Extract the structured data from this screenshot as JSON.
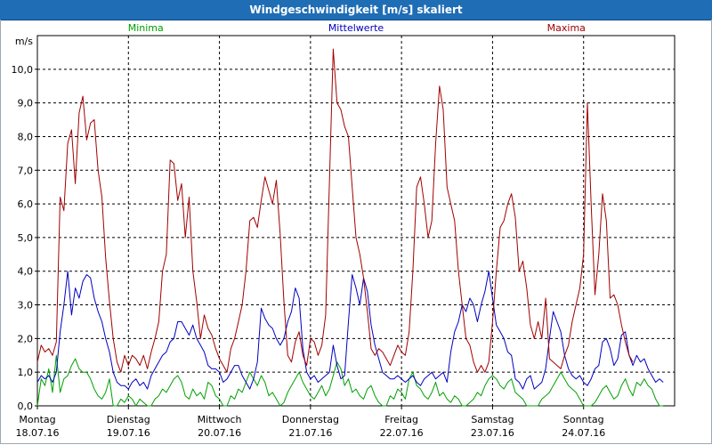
{
  "window": {
    "title": "Windgeschwindigkeit [m/s] skaliert"
  },
  "colors": {
    "title_bar": "#1f6db5",
    "minima": "#00a000",
    "mittelwerte": "#0000c0",
    "maxima": "#a00000"
  },
  "chart_data": {
    "type": "line",
    "title": "Windgeschwindigkeit [m/s] skaliert",
    "ylabel": "m/s",
    "xlabel": "",
    "ylim": [
      0,
      11
    ],
    "yticks": [
      "0,0",
      "1,0",
      "2,0",
      "3,0",
      "4,0",
      "5,0",
      "6,0",
      "7,0",
      "8,0",
      "9,0",
      "10,0"
    ],
    "x_categories": [
      {
        "day": "Montag",
        "date": "18.07.16"
      },
      {
        "day": "Dienstag",
        "date": "19.07.16"
      },
      {
        "day": "Mittwoch",
        "date": "20.07.16"
      },
      {
        "day": "Donnerstag",
        "date": "21.07.16"
      },
      {
        "day": "Freitag",
        "date": "22.07.16"
      },
      {
        "day": "Samstag",
        "date": "23.07.16"
      },
      {
        "day": "Sonntag",
        "date": "24.07.16"
      }
    ],
    "grid": true,
    "legend_placement": "top",
    "samples_per_day": 24,
    "series": [
      {
        "name": "Minima",
        "color": "#00a000",
        "values": [
          0,
          0.8,
          0.6,
          1.1,
          0.4,
          1.5,
          0.4,
          0.8,
          0.9,
          1.2,
          1.4,
          1.1,
          1,
          1,
          0.8,
          0.5,
          0.3,
          0.2,
          0.4,
          0.8,
          0,
          0,
          0.2,
          0.1,
          0.3,
          0.2,
          0,
          0.2,
          0.1,
          0,
          0,
          0.2,
          0.3,
          0.5,
          0.4,
          0.6,
          0.8,
          0.9,
          0.7,
          0.3,
          0.2,
          0.5,
          0.3,
          0.4,
          0.2,
          0.7,
          0.6,
          0.3,
          0.2,
          0,
          0,
          0.3,
          0.2,
          0.5,
          0.4,
          0.7,
          1,
          0.8,
          0.6,
          0.9,
          0.7,
          0.3,
          0.4,
          0.2,
          0,
          0.1,
          0.4,
          0.6,
          0.8,
          1,
          0.7,
          0.5,
          0.3,
          0.2,
          0.4,
          0.6,
          0.3,
          0.5,
          0.9,
          1.3,
          1.1,
          0.6,
          0.8,
          0.4,
          0.5,
          0.3,
          0.2,
          0.5,
          0.6,
          0.3,
          0.1,
          0,
          0,
          0.3,
          0.2,
          0.5,
          0.4,
          0.2,
          0.8,
          1.0,
          0.6,
          0.5,
          0.3,
          0.2,
          0.4,
          0.7,
          0.3,
          0.4,
          0.2,
          0.1,
          0.3,
          0.2,
          0,
          0,
          0.1,
          0.2,
          0.4,
          0.3,
          0.6,
          0.8,
          0.9,
          0.8,
          0.6,
          0.5,
          0.7,
          0.8,
          0.4,
          0.3,
          0.2,
          0,
          0,
          0,
          0,
          0.2,
          0.3,
          0.4,
          0.6,
          0.8,
          1.0,
          0.8,
          0.6,
          0.5,
          0.4,
          0.2,
          0,
          0,
          0,
          0.1,
          0.3,
          0.5,
          0.6,
          0.4,
          0.2,
          0.3,
          0.6,
          0.8,
          0.5,
          0.3,
          0.7,
          0.6,
          0.8,
          0.6,
          0.5,
          0.2,
          0,
          0
        ]
      },
      {
        "name": "Mittelwerte",
        "color": "#0000c0",
        "values": [
          0.7,
          0.9,
          0.8,
          0.9,
          0.7,
          1,
          2.2,
          3,
          4,
          2.7,
          3.5,
          3.2,
          3.7,
          3.9,
          3.8,
          3.2,
          2.8,
          2.5,
          2,
          1.6,
          1,
          0.7,
          0.6,
          0.6,
          0.5,
          0.7,
          0.8,
          0.6,
          0.7,
          0.5,
          0.9,
          1.1,
          1.3,
          1.5,
          1.6,
          1.9,
          2,
          2.5,
          2.5,
          2.3,
          2.1,
          2.4,
          2.0,
          1.8,
          1.6,
          1.2,
          1.1,
          1.1,
          1,
          0.7,
          0.8,
          1,
          1.2,
          1.2,
          0.9,
          0.7,
          0.5,
          0.8,
          1.3,
          2.9,
          2.6,
          2.4,
          2.3,
          2,
          1.8,
          2,
          2.5,
          2.8,
          3.5,
          3.2,
          1.7,
          1,
          0.8,
          0.9,
          0.7,
          0.8,
          0.9,
          1,
          1.8,
          1.2,
          0.8,
          0.9,
          2.5,
          3.9,
          3.5,
          3,
          3.8,
          3.4,
          2.4,
          1.8,
          1.4,
          1.0,
          0.9,
          0.8,
          0.8,
          0.9,
          0.8,
          0.7,
          0.8,
          0.9,
          0.7,
          0.6,
          0.8,
          0.9,
          1,
          0.8,
          0.9,
          1,
          0.7,
          1.6,
          2.2,
          2.5,
          3.0,
          2.8,
          3.2,
          3.0,
          2.5,
          3.0,
          3.4,
          4,
          3.2,
          2.4,
          2.2,
          2,
          1.6,
          1.5,
          0.8,
          0.7,
          0.5,
          0.8,
          0.9,
          0.5,
          0.6,
          0.7,
          1.1,
          2,
          2.8,
          2.5,
          2.2,
          1.5,
          1.1,
          0.9,
          0.8,
          0.9,
          0.7,
          0.6,
          0.8,
          1.1,
          1.2,
          1.9,
          2,
          1.7,
          1.2,
          1.4,
          2.1,
          2.2,
          1.5,
          1.2,
          1.5,
          1.3,
          1.4,
          1.1,
          0.9,
          0.7,
          0.8,
          0.7
        ]
      },
      {
        "name": "Maxima",
        "color": "#a00000",
        "values": [
          1.3,
          1.8,
          1.6,
          1.7,
          1.5,
          1.9,
          6.2,
          5.8,
          7.8,
          8.2,
          6.6,
          8.7,
          9.2,
          7.9,
          8.4,
          8.5,
          7,
          6.2,
          4.4,
          3.1,
          2,
          1.3,
          1,
          1.5,
          1.2,
          1.5,
          1.4,
          1.2,
          1.5,
          1.1,
          1.6,
          2,
          2.5,
          4,
          4.5,
          7.3,
          7.2,
          6.1,
          6.6,
          5,
          6.2,
          4,
          3.1,
          2,
          2.7,
          2.3,
          2.1,
          1.7,
          1.4,
          1.2,
          1.0,
          1.7,
          2,
          2.5,
          3,
          4,
          5.5,
          5.6,
          5.3,
          6.1,
          6.8,
          6.4,
          6.0,
          6.7,
          5.1,
          3.1,
          1.5,
          1.3,
          1.9,
          2.2,
          1.5,
          1.2,
          2.0,
          1.9,
          1.5,
          1.8,
          2.7,
          6.7,
          10.6,
          9.0,
          8.8,
          8.3,
          8.0,
          6.5,
          5.0,
          4.5,
          3.8,
          2.8,
          1.7,
          1.5,
          1.7,
          1.6,
          1.4,
          1.2,
          1.5,
          1.8,
          1.6,
          1.5,
          2.2,
          4.0,
          6.5,
          6.8,
          6.0,
          5.0,
          5.5,
          7.8,
          9.5,
          8.8,
          6.5,
          6.0,
          5.5,
          4.0,
          3.0,
          2.0,
          1.8,
          1.3,
          1.0,
          1.2,
          1.0,
          1.3,
          2.5,
          4.0,
          5.3,
          5.5,
          6.0,
          6.3,
          5.6,
          4.0,
          4.3,
          3.5,
          2.4,
          2.0,
          2.5,
          2.0,
          3.2,
          1.4,
          1.3,
          1.2,
          1.1,
          1.5,
          1.8,
          2.5,
          3.0,
          3.5,
          4.5,
          9.0,
          6.0,
          3.3,
          4.5,
          6.3,
          5.5,
          3.2,
          3.3,
          3.0,
          2.4,
          1.9,
          1.5,
          1.3
        ]
      }
    ]
  }
}
